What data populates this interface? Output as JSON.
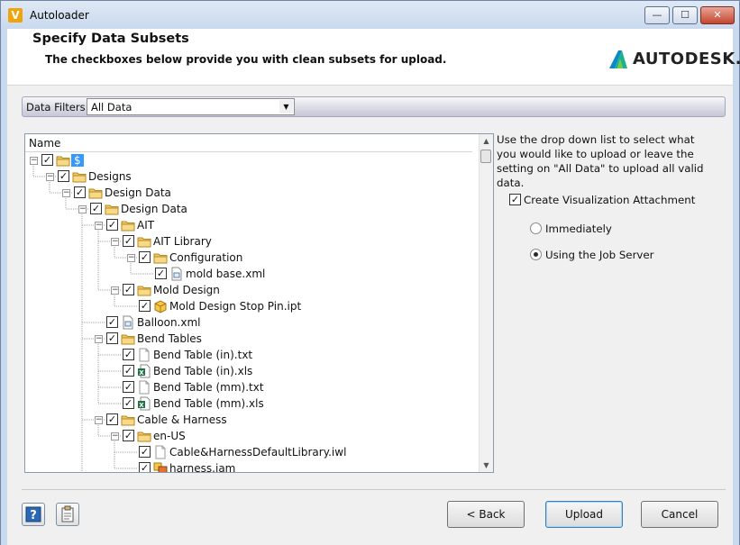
{
  "window": {
    "title": "Autoloader",
    "app_icon_letter": "V",
    "minimize_glyph": "—",
    "maximize_glyph": "☐",
    "close_glyph": "✕"
  },
  "header": {
    "title": "Specify Data Subsets",
    "subtitle": "The checkboxes below provide you with clean subsets for upload.",
    "logo_text": "AUTODESK."
  },
  "filter": {
    "label": "Data Filters:",
    "selected": "All Data"
  },
  "tree": {
    "column_header": "Name",
    "check_glyph": "✓",
    "items": [
      {
        "label": "$",
        "icon": "folder-icon",
        "checked": true,
        "selected": true
      },
      {
        "label": "Designs",
        "icon": "folder-icon",
        "checked": true
      },
      {
        "label": "Design Data",
        "icon": "folder-icon",
        "checked": true
      },
      {
        "label": "Design Data",
        "icon": "folder-icon",
        "checked": true
      },
      {
        "label": "AIT",
        "icon": "folder-icon",
        "checked": true
      },
      {
        "label": "AIT Library",
        "icon": "folder-icon",
        "checked": true
      },
      {
        "label": "Configuration",
        "icon": "folder-icon",
        "checked": true
      },
      {
        "label": "mold base.xml",
        "icon": "xml-file-icon",
        "checked": true
      },
      {
        "label": "Mold Design",
        "icon": "folder-icon",
        "checked": true
      },
      {
        "label": "Mold Design Stop Pin.ipt",
        "icon": "part-file-icon",
        "checked": true
      },
      {
        "label": "Balloon.xml",
        "icon": "xml-file-icon",
        "checked": true
      },
      {
        "label": "Bend Tables",
        "icon": "folder-icon",
        "checked": true
      },
      {
        "label": "Bend Table (in).txt",
        "icon": "text-file-icon",
        "checked": true
      },
      {
        "label": "Bend Table (in).xls",
        "icon": "excel-file-icon",
        "checked": true
      },
      {
        "label": "Bend Table (mm).txt",
        "icon": "text-file-icon",
        "checked": true
      },
      {
        "label": "Bend Table (mm).xls",
        "icon": "excel-file-icon",
        "checked": true
      },
      {
        "label": "Cable & Harness",
        "icon": "folder-icon",
        "checked": true
      },
      {
        "label": "en-US",
        "icon": "folder-icon",
        "checked": true
      },
      {
        "label": "Cable&HarnessDefaultLibrary.iwl",
        "icon": "text-file-icon",
        "checked": true
      },
      {
        "label": "harness.iam",
        "icon": "assembly-file-icon",
        "checked": true
      }
    ]
  },
  "options": {
    "info_text": "Use the drop down list to select what you would like to upload or leave the setting on \"All Data\" to upload all valid data.",
    "viz_label": "Create Visualization Attachment",
    "viz_checked": true,
    "radio_immediately": "Immediately",
    "radio_job_server": "Using the Job Server",
    "selected_radio": "Using the Job Server"
  },
  "footer": {
    "back_label": "< Back",
    "upload_label": "Upload",
    "cancel_label": "Cancel"
  }
}
